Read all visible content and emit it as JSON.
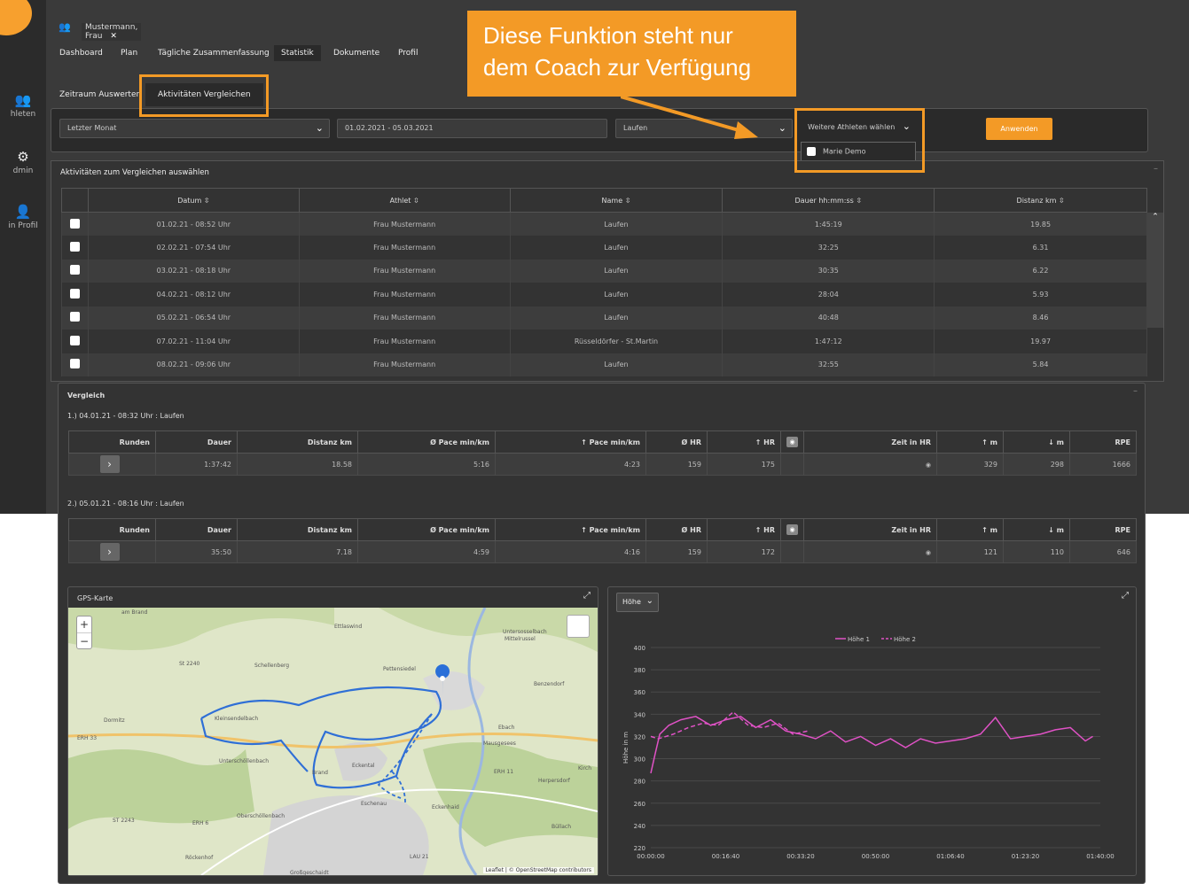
{
  "callout": {
    "text_line1": "Diese Funktion steht nur",
    "text_line2": "dem Coach zur Verfügung"
  },
  "sidebar": {
    "items": [
      {
        "label": "hleten",
        "icon": "users-icon"
      },
      {
        "label": "dmin",
        "icon": "gear-icon"
      },
      {
        "label": "in Profil",
        "icon": "user-icon"
      }
    ]
  },
  "top_tab": {
    "label": "Mustermann, Frau",
    "close": "✕"
  },
  "nav": {
    "items": [
      "Dashboard",
      "Plan",
      "Tägliche Zusammenfassung",
      "Statistik",
      "Dokumente",
      "Profil"
    ],
    "active": "Statistik"
  },
  "subnav": {
    "items": [
      "Zeitraum Auswerten",
      "Aktivitäten Vergleichen"
    ],
    "active": "Aktivitäten Vergleichen"
  },
  "filters": {
    "period": "Letzter Monat",
    "daterange": "01.02.2021 - 05.03.2021",
    "sport": "Laufen",
    "athletes": "Weitere Athleten wählen",
    "athlete_option": "Marie Demo",
    "apply": "Anwenden"
  },
  "activities": {
    "title": "Aktivitäten zum Vergleichen auswählen",
    "columns": [
      "Datum",
      "Athlet",
      "Name",
      "Dauer hh:mm:ss",
      "Distanz km"
    ],
    "rows": [
      [
        "01.02.21 - 08:52 Uhr",
        "Frau Mustermann",
        "Laufen",
        "1:45:19",
        "19.85"
      ],
      [
        "02.02.21 - 07:54 Uhr",
        "Frau Mustermann",
        "Laufen",
        "32:25",
        "6.31"
      ],
      [
        "03.02.21 - 08:18 Uhr",
        "Frau Mustermann",
        "Laufen",
        "30:35",
        "6.22"
      ],
      [
        "04.02.21 - 08:12 Uhr",
        "Frau Mustermann",
        "Laufen",
        "28:04",
        "5.93"
      ],
      [
        "05.02.21 - 06:54 Uhr",
        "Frau Mustermann",
        "Laufen",
        "40:48",
        "8.46"
      ],
      [
        "07.02.21 - 11:04 Uhr",
        "Frau Mustermann",
        "Rüsseldörfer - St.Martin",
        "1:47:12",
        "19.97"
      ],
      [
        "08.02.21 - 09:06 Uhr",
        "Frau Mustermann",
        "Laufen",
        "32:55",
        "5.84"
      ]
    ]
  },
  "compare": {
    "title": "Vergleich",
    "columns": [
      "Runden",
      "Dauer",
      "Distanz km",
      "Ø Pace min/km",
      "↑ Pace min/km",
      "Ø HR",
      "↑ HR",
      "",
      "Zeit in HR",
      "↑ m",
      "↓ m",
      "RPE"
    ],
    "blocks": [
      {
        "heading": "1.) 04.01.21 - 08:32 Uhr : Laufen",
        "values": [
          "1:37:42",
          "18.58",
          "5:16",
          "4:23",
          "159",
          "175",
          "329",
          "298",
          "1666"
        ]
      },
      {
        "heading": "2.) 05.01.21 - 08:16 Uhr : Laufen",
        "values": [
          "35:50",
          "7.18",
          "4:59",
          "4:16",
          "159",
          "172",
          "121",
          "110",
          "646"
        ]
      }
    ]
  },
  "map": {
    "title": "GPS-Karte",
    "attribution": "Leaflet | © OpenStreetMap contributors",
    "labels": [
      "am Brand",
      "Ettlaswind",
      "Untersosselbach",
      "Mittelrussel",
      "Schellenberg",
      "Pettensiedel",
      "Benzendorf",
      "Dormitz",
      "Kleinsendelbach",
      "Ebach",
      "Mausgesees",
      "ERH 33",
      "Unterschöllenbach",
      "Eckental",
      "Brand",
      "ERH 11",
      "Herpersdorf",
      "Eschenau",
      "Eckenhaid",
      "Oberschöllenbach",
      "ST 2243",
      "ERH 6",
      "Büllach",
      "Röckenhof",
      "LAU 21",
      "Großgeschaidt",
      "St 2240",
      "Kirch"
    ]
  },
  "chart_data": {
    "type": "line",
    "dropdown": "Höhe",
    "ylabel": "Höhe in m",
    "ylim": [
      220,
      400
    ],
    "yticks": [
      220,
      240,
      260,
      280,
      300,
      320,
      340,
      360,
      380,
      400
    ],
    "xticks": [
      "00:00:00",
      "00:16:40",
      "00:33:20",
      "00:50:00",
      "01:06:40",
      "01:23:20",
      "01:40:00"
    ],
    "xlim_seconds": [
      0,
      6000
    ],
    "series": [
      {
        "name": "Höhe 1",
        "color": "#e052c6",
        "style": "solid",
        "x": [
          0,
          60,
          120,
          240,
          400,
          600,
          800,
          1000,
          1200,
          1400,
          1600,
          1800,
          2000,
          2200,
          2400,
          2600,
          2800,
          3000,
          3200,
          3400,
          3600,
          3800,
          4000,
          4200,
          4400,
          4600,
          4800,
          5000,
          5200,
          5400,
          5600,
          5800,
          5900
        ],
        "values": [
          287,
          305,
          322,
          330,
          335,
          338,
          330,
          335,
          338,
          328,
          335,
          325,
          322,
          318,
          325,
          315,
          320,
          312,
          318,
          310,
          318,
          314,
          316,
          318,
          322,
          337,
          318,
          320,
          322,
          326,
          328,
          316,
          320
        ]
      },
      {
        "name": "Höhe 2",
        "color": "#e052c6",
        "style": "dashed",
        "x": [
          0,
          100,
          300,
          500,
          700,
          900,
          1100,
          1300,
          1500,
          1700,
          1900,
          2100
        ],
        "values": [
          320,
          318,
          322,
          328,
          332,
          330,
          342,
          330,
          328,
          332,
          322,
          325
        ]
      }
    ]
  }
}
